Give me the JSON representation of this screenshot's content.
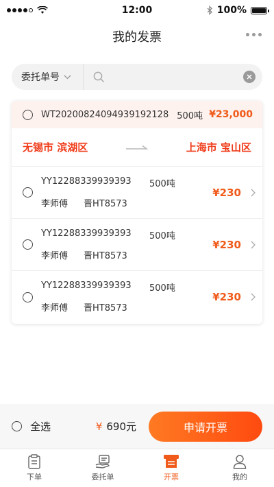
{
  "status_bar": {
    "time": "12:00",
    "battery": "100%",
    "battery_level": 1.0
  },
  "header": {
    "title": "我的发票"
  },
  "search": {
    "filter_label": "委托单号",
    "placeholder": ""
  },
  "order": {
    "order_no": "WT20200824094939192128",
    "weight": "500吨",
    "amount": "¥23,000",
    "from": "无锡市 滨湖区",
    "to": "上海市 宝山区",
    "items": [
      {
        "no": "YY12288339939393",
        "weight": "500吨",
        "driver": "李师傅",
        "plate": "晋HT8573",
        "amount": "¥230"
      },
      {
        "no": "YY12288339939393",
        "weight": "500吨",
        "driver": "李师傅",
        "plate": "晋HT8573",
        "amount": "¥230"
      },
      {
        "no": "YY12288339939393",
        "weight": "500吨",
        "driver": "李师傅",
        "plate": "晋HT8573",
        "amount": "¥230"
      }
    ]
  },
  "footer": {
    "select_all": "全选",
    "currency": "¥",
    "total": "690元",
    "apply_label": "申请开票"
  },
  "tabs": [
    {
      "label": "下单",
      "icon": "clipboard-icon"
    },
    {
      "label": "委托单",
      "icon": "hand-docs-icon"
    },
    {
      "label": "开票",
      "icon": "invoice-icon"
    },
    {
      "label": "我的",
      "icon": "user-icon"
    }
  ],
  "colors": {
    "accent": "#f05a1a",
    "route_red": "#f03c1a",
    "header_bg": "#fdf2ee"
  }
}
